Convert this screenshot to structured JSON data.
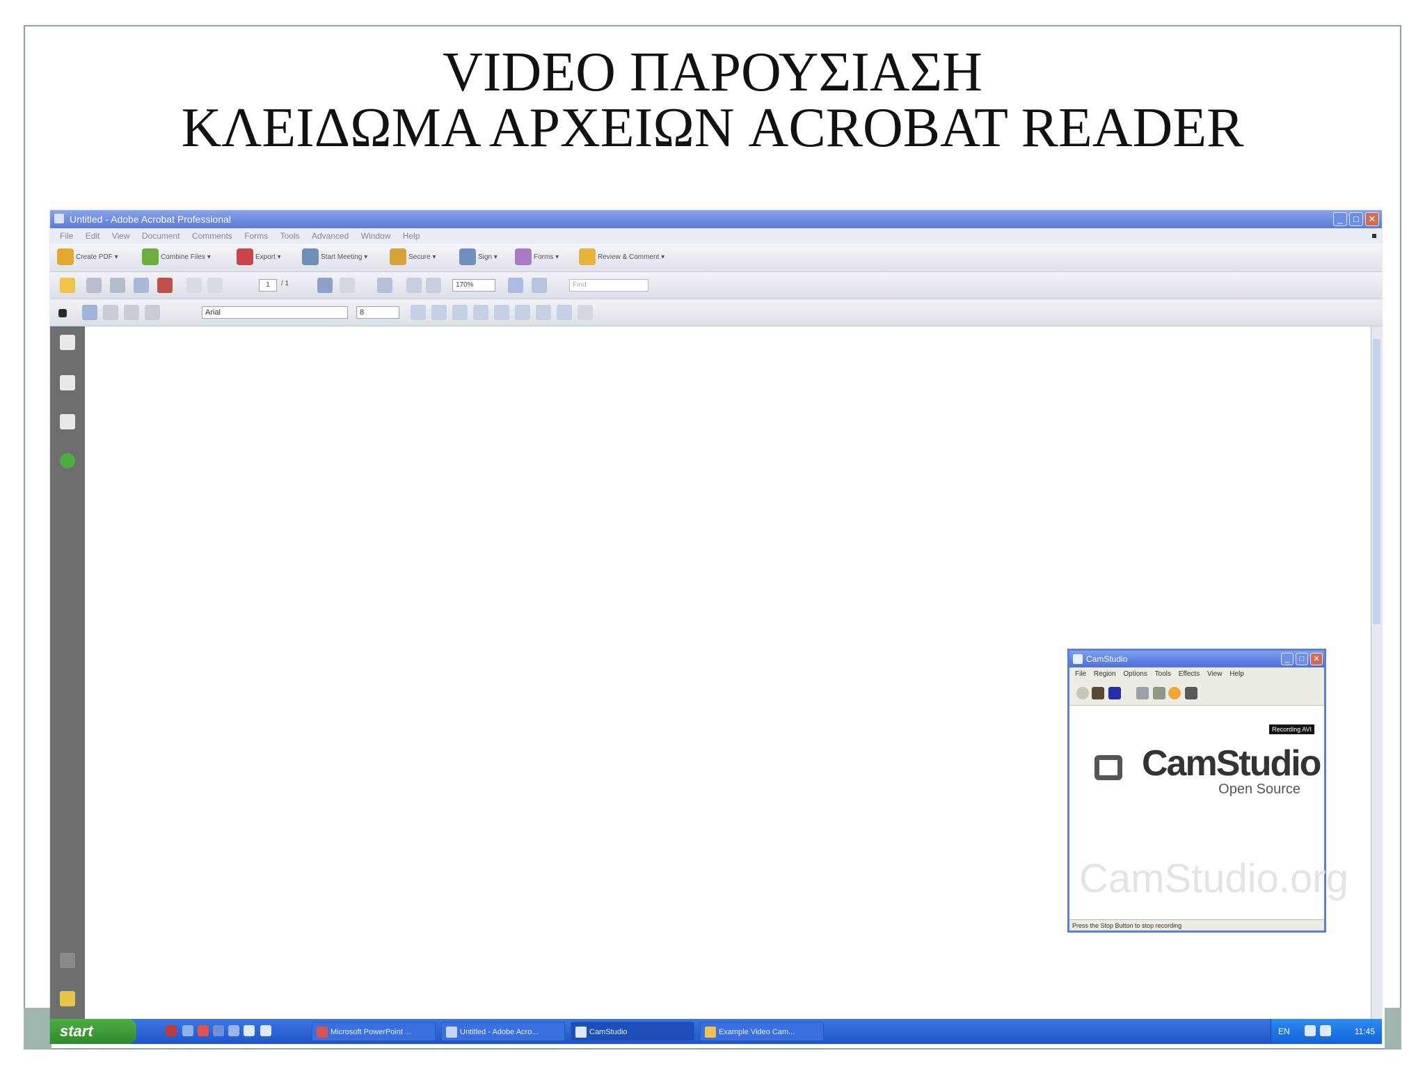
{
  "slide": {
    "title_line1": "VIDEO ΠΑΡΟΥΣΙΑΣΗ",
    "title_line2": "ΚΛΕΙΔΩΜΑ ΑΡΧΕΙΩΝ ACROBAT READER"
  },
  "acrobat": {
    "window_title": "Untitled - Adobe Acrobat Professional",
    "window_buttons": {
      "minimize": "_",
      "maximize": "□",
      "close": "✕"
    },
    "menu": [
      "File",
      "Edit",
      "View",
      "Document",
      "Comments",
      "Forms",
      "Tools",
      "Advanced",
      "Window",
      "Help"
    ],
    "tasks": [
      {
        "label": "Create PDF ▾",
        "color": "#e4a72f"
      },
      {
        "label": "Combine Files ▾",
        "color": "#6cae3d"
      },
      {
        "label": "Export ▾",
        "color": "#c9434b"
      },
      {
        "label": "Start Meeting ▾",
        "color": "#6f8fb6"
      },
      {
        "label": "Secure ▾",
        "color": "#d8a23a"
      },
      {
        "label": "Sign ▾",
        "color": "#6f8fbf"
      },
      {
        "label": "Forms ▾",
        "color": "#a77cc6"
      },
      {
        "label": "Review & Comment ▾",
        "color": "#e7b43c"
      }
    ],
    "page_number": "1",
    "page_total": "/ 1",
    "zoom": "170%",
    "find_placeholder": "Find",
    "font_name": "Arial",
    "font_size": "8"
  },
  "taskbar": {
    "start_label": "start",
    "tasks": [
      {
        "label": "Microsoft PowerPoint ...",
        "color": "#d9534f"
      },
      {
        "label": "Untitled - Adobe Acro...",
        "color": "#c8d4f2"
      },
      {
        "label": "CamStudio",
        "color": "#dfe7fb"
      },
      {
        "label": "Example Video Cam...",
        "color": "#f2c14e"
      }
    ],
    "tray_lang": "EN",
    "clock": "11:45"
  },
  "camstudio": {
    "title": "CamStudio",
    "menu": [
      "File",
      "Region",
      "Options",
      "Tools",
      "Effects",
      "View",
      "Help"
    ],
    "recording_tag": "Recording AVI",
    "logo_text": "CamStudio",
    "logo_subtitle": "Open Source",
    "watermark": "CamStudio.org",
    "status": "Press the Stop Button to stop recording"
  }
}
